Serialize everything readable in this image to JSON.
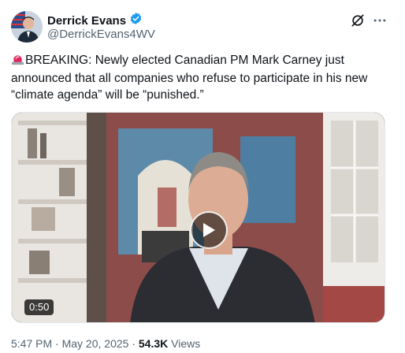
{
  "author": {
    "display_name": "Derrick Evans",
    "handle": "@DerrickEvans4WV",
    "verified": true,
    "verified_color": "#1d9bf0"
  },
  "header_icons": [
    "grok-icon",
    "more-icon"
  ],
  "tweet": {
    "emoji": "rotating-light-icon",
    "text": "BREAKING: Newly elected Canadian PM Mark Carney just announced that all companies who refuse to participate in his new “climate agenda” will be “punished.”"
  },
  "media": {
    "type": "video",
    "duration": "0:50"
  },
  "meta": {
    "time": "5:47 PM",
    "separator": "·",
    "date": "May 20, 2025",
    "views_count": "54.3K",
    "views_label": "Views"
  }
}
